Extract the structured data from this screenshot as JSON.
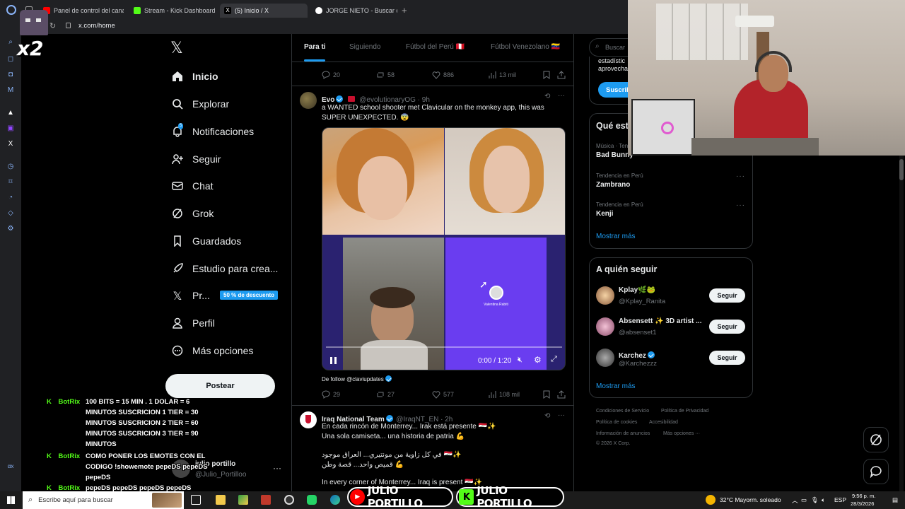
{
  "browser": {
    "tabs": [
      {
        "label": "Panel de control del canal"
      },
      {
        "label": "Stream - Kick Dashboard"
      },
      {
        "label": "(5) Inicio / X"
      },
      {
        "label": "JORGE NIETO - Buscar co"
      }
    ],
    "url": "x.com/home"
  },
  "overlay": {
    "multiplier": "x2"
  },
  "nav": {
    "items": [
      {
        "label": "Inicio"
      },
      {
        "label": "Explorar"
      },
      {
        "label": "Notificaciones",
        "badge": "5"
      },
      {
        "label": "Seguir"
      },
      {
        "label": "Chat"
      },
      {
        "label": "Grok"
      },
      {
        "label": "Guardados"
      },
      {
        "label": "Estudio para crea..."
      },
      {
        "label": "Pr...",
        "badge": "50 % de descuento"
      },
      {
        "label": "Perfil"
      },
      {
        "label": "Más opciones"
      }
    ],
    "post_label": "Postear",
    "account": {
      "name": "julio portillo",
      "handle": "@Julio_Portilloo"
    }
  },
  "feed": {
    "tabs": [
      "Para ti",
      "Siguiendo",
      "Fútbol del Perú 🇵🇪",
      "Fútbol Venezolano 🇻🇪"
    ],
    "top_actions": {
      "replies": "20",
      "reposts": "58",
      "likes": "886",
      "views": "13 mil"
    },
    "tweet1": {
      "name": "Evo",
      "handle": "@evolutionaryOG · 9h",
      "text": "a WANTED school shooter met Clavicular on the monkey app, this was SUPER UNEXPECTED. 😨",
      "video_time": "0:00 / 1:20",
      "video_caption_name": "Valentina Rabiti",
      "source": "De follow @claviupdates",
      "actions": {
        "replies": "29",
        "reposts": "27",
        "likes": "577",
        "views": "108 mil"
      }
    },
    "tweet2": {
      "name": "Iraq National Team",
      "handle": "@IraqNT_EN · 2h",
      "lines": [
        "En cada rincón de Monterrey... Irak está presente 🇮🇶✨",
        "Una sola camiseta... una historia de patria 💪",
        "في كل زاوية من مونتيري... العراق موجود 🇮🇶✨",
        "قميص واحد... قصة وطن 💪",
        "In every corner of Monterrey... Iraq is present 🇮🇶✨"
      ]
    }
  },
  "right": {
    "search_placeholder": "Buscar",
    "subscribe_fragment": [
      "estadístic",
      "aprovecha"
    ],
    "subscribe_label": "Suscrib",
    "trends_title": "Qué est",
    "trends": [
      {
        "category": "Música · Tend",
        "name": "Bad Bunny"
      },
      {
        "category": "Tendencia en Perú",
        "name": "Zambrano"
      },
      {
        "category": "Tendencia en Perú",
        "name": "Kenji"
      }
    ],
    "show_more": "Mostrar más",
    "who_title": "A quién seguir",
    "who": [
      {
        "name": "Kplay🌿🐸",
        "handle": "@Kplay_Ranita"
      },
      {
        "name": "Absensett ✨ 3D artist ...",
        "handle": "@absenset1"
      },
      {
        "name": "Karchez",
        "handle": "@Karchezzz"
      }
    ],
    "follow_label": "Seguir",
    "footer": [
      "Condiciones de Servicio",
      "Política de Privacidad",
      "Política de cookies",
      "Accesibilidad",
      "Información de anuncios",
      "Más opciones ···",
      "© 2026 X Corp."
    ]
  },
  "chat": {
    "messages": [
      {
        "user": "BotRix",
        "lines": [
          "100 BITS = 15 MIN . 1 DOLAR = 6",
          "MINUTOS SUSCRICION 1 TIER = 30",
          "MINUTOS SUSCRICION 2 TIER = 60",
          "MINUTOS SUSCRICION 3 TIER = 90",
          "MINUTOS"
        ]
      },
      {
        "user": "BotRix",
        "lines": [
          "COMO PONER LOS EMOTES CON EL",
          "CODIGO !showemote pepeDS pepeDS",
          "pepeDS"
        ]
      },
      {
        "user": "BotRix",
        "lines": [
          "pepeDS pepeDS pepeDS pepeDS"
        ]
      }
    ]
  },
  "taskbar": {
    "search_placeholder": "Escribe aquí para buscar",
    "weather": "32°C  Mayorm. soleado",
    "lang": "ESP",
    "time": "9:56 p. m.",
    "date": "28/3/2026"
  },
  "banners": [
    "JULIO PORTILLO",
    "JULIO PORTILLO"
  ],
  "colors": {
    "accent": "#1d9bf0",
    "kick": "#53fc18",
    "bg": "#000000"
  }
}
